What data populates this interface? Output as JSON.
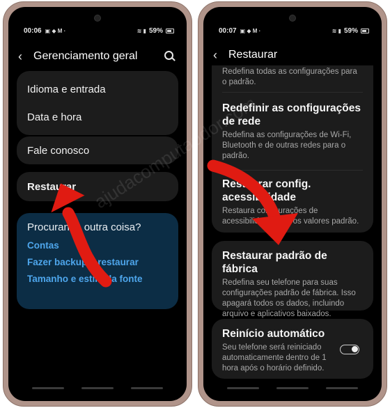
{
  "left_phone": {
    "status": {
      "time": "00:06",
      "battery": "59%"
    },
    "title": "Gerenciamento geral",
    "group1": [
      "Idioma e entrada",
      "Data e hora"
    ],
    "contact": "Fale conosco",
    "reset": "Restaurar",
    "suggestions": {
      "title": "Procurando outra coisa?",
      "links": [
        "Contas",
        "Fazer backup e restaurar",
        "Tamanho e estilo da fonte"
      ]
    }
  },
  "right_phone": {
    "status": {
      "time": "00:07",
      "battery": "59%"
    },
    "title": "Restaurar",
    "top_partial": "Redefina todas as configurações para o padrão.",
    "network": {
      "title": "Redefinir as configurações de rede",
      "desc": "Redefina as configurações de Wi-Fi, Bluetooth e de outras redes para o padrão."
    },
    "accessibility": {
      "title": "Restaurar config. acessibilidade",
      "desc": "Restaura configurações de acessibilidade para os valores padrão."
    },
    "factory": {
      "title": "Restaurar padrão de fábrica",
      "desc": "Redefina seu telefone para suas configurações padrão de fábrica. Isso apagará todos os dados, incluindo arquivo e aplicativos baixados."
    },
    "auto_restart": {
      "title": "Reinício automático",
      "desc": "Seu telefone será reiniciado automaticamente dentro de 1 hora após o horário definido.",
      "enabled": false
    }
  },
  "watermark": "ajudacomputaodor.com",
  "colors": {
    "accent_link": "#4ea6ec",
    "arrow": "#e01b12",
    "suggest_bg": "#0c2d45"
  }
}
